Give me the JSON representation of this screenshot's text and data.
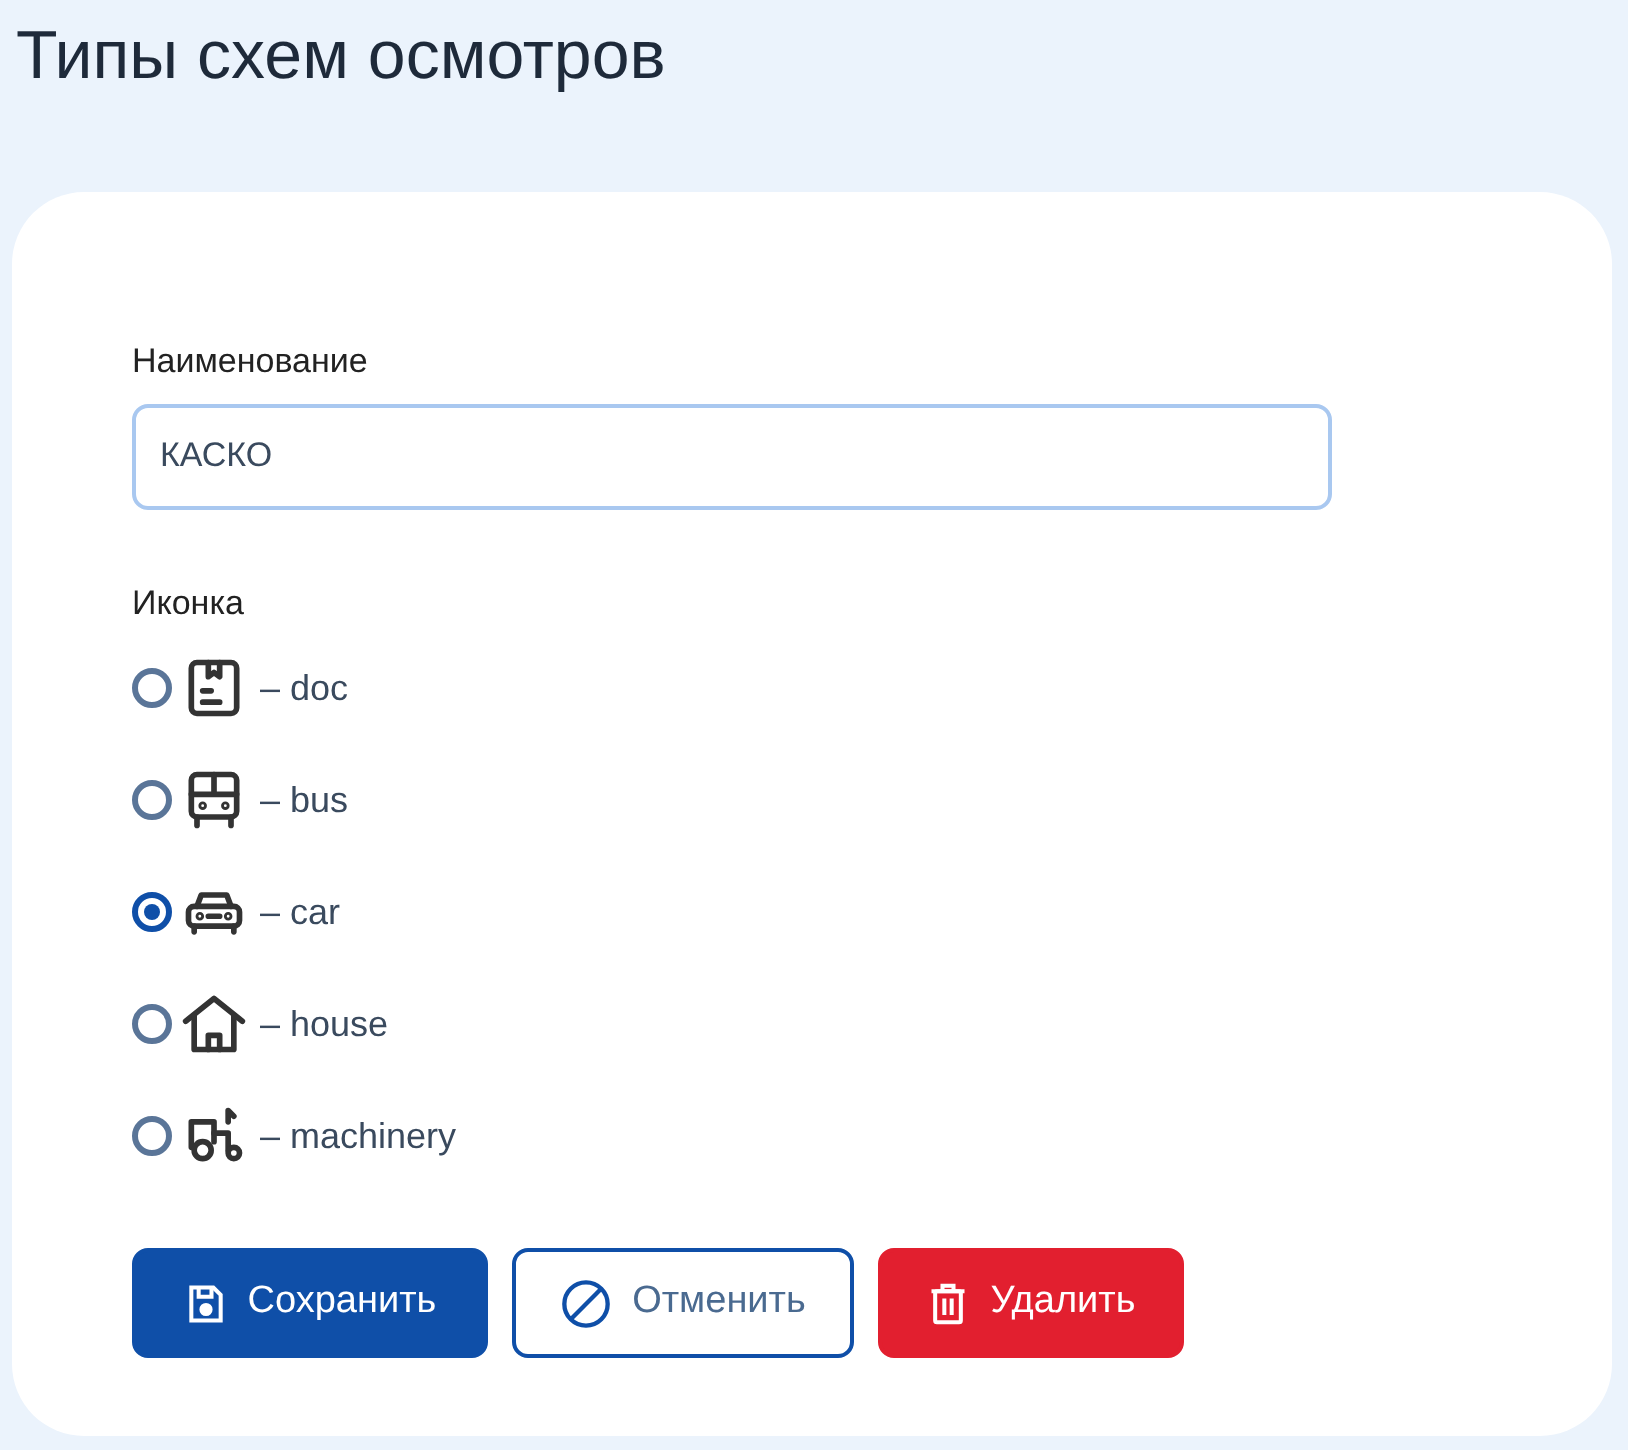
{
  "page_title": "Типы схем осмотров",
  "name_field": {
    "label": "Наименование",
    "value": "КАСКО"
  },
  "icon_group": {
    "label": "Иконка",
    "options": [
      {
        "kind": "doc",
        "label": "– doc",
        "selected": false
      },
      {
        "kind": "bus",
        "label": "– bus",
        "selected": false
      },
      {
        "kind": "car",
        "label": "– car",
        "selected": true
      },
      {
        "kind": "house",
        "label": "– house",
        "selected": false
      },
      {
        "kind": "machinery",
        "label": "– machinery",
        "selected": false
      }
    ]
  },
  "buttons": [
    {
      "kind": "save",
      "label": "Сохранить"
    },
    {
      "kind": "cancel",
      "label": "Отменить"
    },
    {
      "kind": "delete",
      "label": "Удалить"
    }
  ]
}
